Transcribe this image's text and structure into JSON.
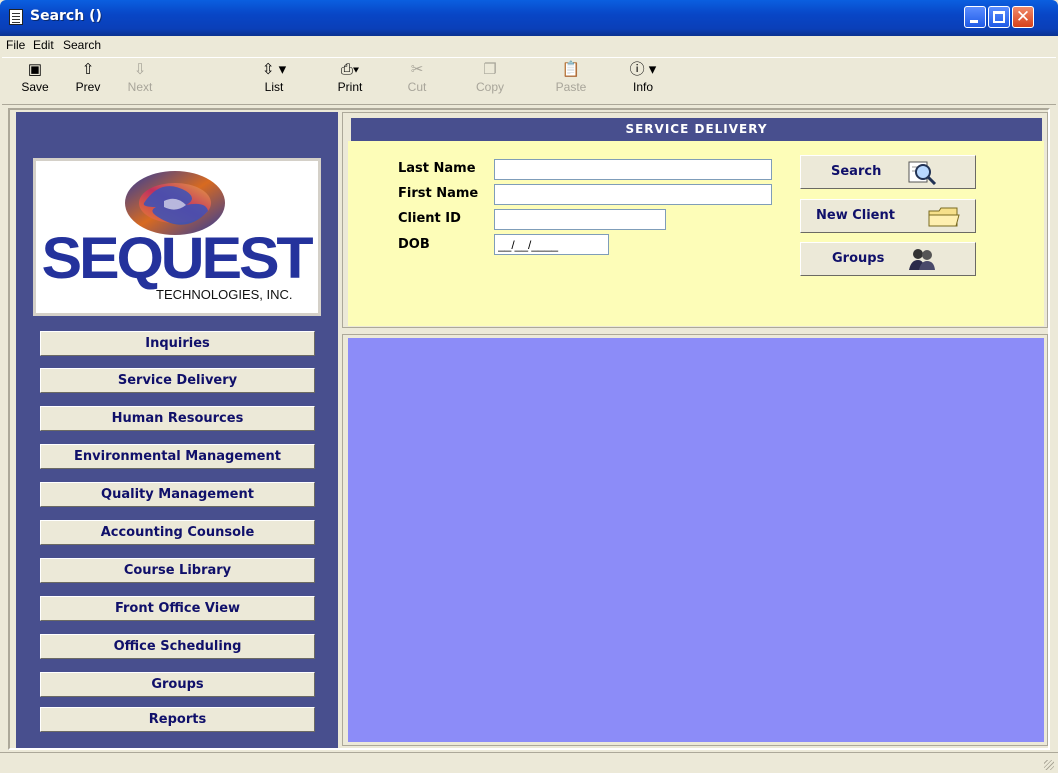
{
  "window": {
    "title": "Search ()"
  },
  "menu": [
    "File",
    "Edit",
    "Search"
  ],
  "toolbar": [
    {
      "label": "Save",
      "icon": "floppy-icon",
      "enabled": true
    },
    {
      "label": "Prev",
      "icon": "up-arrow-icon",
      "enabled": true
    },
    {
      "label": "Next",
      "icon": "down-arrow-icon",
      "enabled": false
    },
    {
      "label": "List",
      "icon": "list-icon",
      "enabled": true
    },
    {
      "label": "Print",
      "icon": "printer-icon",
      "enabled": true
    },
    {
      "label": "Cut",
      "icon": "scissors-icon",
      "enabled": false
    },
    {
      "label": "Copy",
      "icon": "copy-icon",
      "enabled": false
    },
    {
      "label": "Paste",
      "icon": "clipboard-icon",
      "enabled": false
    },
    {
      "label": "Info",
      "icon": "info-icon",
      "enabled": true
    }
  ],
  "logo": {
    "name": "SEQUEST",
    "subtitle": "TECHNOLOGIES, INC."
  },
  "nav": [
    "Inquiries",
    "Service Delivery",
    "Human Resources",
    "Environmental Management",
    "Quality Management",
    "Accounting Counsole",
    "Course Library",
    "Front Office View",
    "Office Scheduling",
    "Groups",
    "Reports"
  ],
  "panel": {
    "header": "SERVICE DELIVERY",
    "fields": {
      "last_name": {
        "label": "Last Name",
        "value": ""
      },
      "first_name": {
        "label": "First Name",
        "value": ""
      },
      "client_id": {
        "label": "Client ID",
        "value": ""
      },
      "dob": {
        "label": "DOB",
        "value": "__/__/____"
      }
    },
    "buttons": {
      "search": "Search",
      "new_client": "New Client",
      "groups": "Groups"
    }
  },
  "colors": {
    "nav_panel": "#484f8e",
    "form_background": "#fdfdb8",
    "results_background": "#8c8cf8",
    "button_text": "#10106a"
  }
}
